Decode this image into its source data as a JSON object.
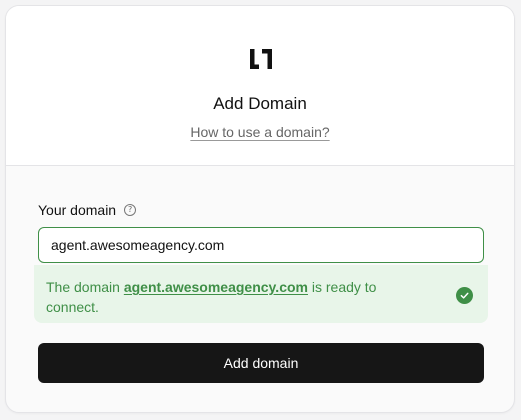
{
  "header": {
    "logo_icon": "brand-logo-icon",
    "title": "Add Domain",
    "help_link": "How to use a domain?"
  },
  "form": {
    "label": "Your domain",
    "help_icon": "question-circle-icon",
    "domain_value": "agent.awesomeagency.com",
    "success": {
      "prefix": "The domain ",
      "domain": "agent.awesomeagency.com",
      "suffix": " is ready to connect.",
      "icon": "check-circle-icon",
      "color": "#3f8f47",
      "background": "#e8f5e9"
    },
    "submit_label": "Add domain"
  },
  "colors": {
    "button_bg": "#161616",
    "card_bg": "#fafafa",
    "header_bg": "#ffffff"
  }
}
